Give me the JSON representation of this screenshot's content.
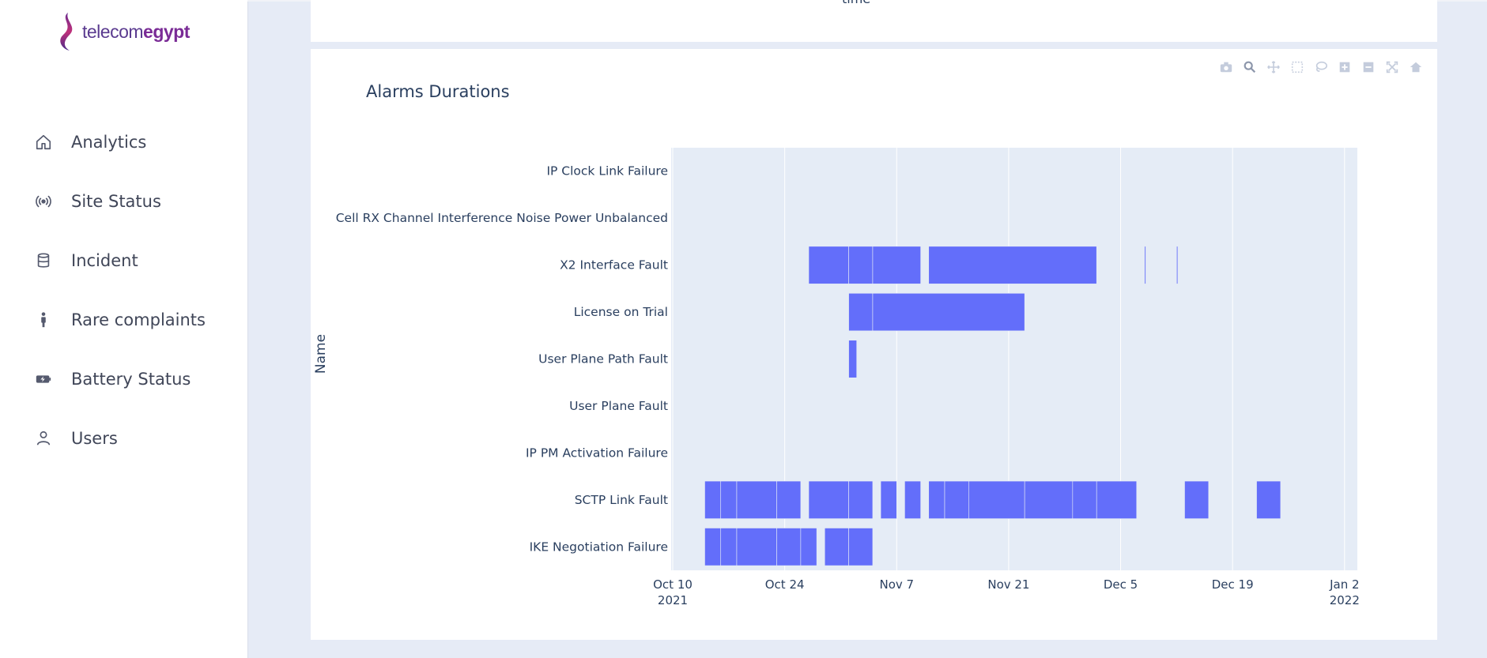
{
  "sidebar": {
    "logo": {
      "prefix": "telecom",
      "suffix": "egypt"
    },
    "items": [
      {
        "label": "Analytics",
        "icon": "home-icon"
      },
      {
        "label": "Site Status",
        "icon": "broadcast-icon"
      },
      {
        "label": "Incident",
        "icon": "database-icon"
      },
      {
        "label": "Rare complaints",
        "icon": "person-icon"
      },
      {
        "label": "Battery Status",
        "icon": "battery-icon"
      },
      {
        "label": "Users",
        "icon": "user-icon"
      }
    ]
  },
  "top_card": {
    "axis_label_cut": "time"
  },
  "chart": {
    "title": "Alarms Durations",
    "modebar": [
      "camera-icon",
      "zoom-icon",
      "pan-icon",
      "box-select-icon",
      "lasso-icon",
      "zoom-in-icon",
      "zoom-out-icon",
      "autoscale-icon",
      "reset-axes-icon"
    ]
  },
  "chart_data": {
    "type": "timeline",
    "title": "Alarms Durations",
    "xlabel": "",
    "ylabel": "Name",
    "x_ticks": [
      {
        "value": "2021-10-10",
        "label": "Oct 10",
        "sublabel": "2021"
      },
      {
        "value": "2021-10-24",
        "label": "Oct 24",
        "sublabel": ""
      },
      {
        "value": "2021-11-07",
        "label": "Nov 7",
        "sublabel": ""
      },
      {
        "value": "2021-11-21",
        "label": "Nov 21",
        "sublabel": ""
      },
      {
        "value": "2021-12-05",
        "label": "Dec 5",
        "sublabel": ""
      },
      {
        "value": "2021-12-19",
        "label": "Dec 19",
        "sublabel": ""
      },
      {
        "value": "2022-01-02",
        "label": "Jan 2",
        "sublabel": "2022"
      }
    ],
    "xlim": [
      "2021-10-10",
      "2022-01-04"
    ],
    "bar_color": "#636efa",
    "background": "#e5ecf6",
    "categories": [
      "IP Clock Link Failure",
      "Cell RX Channel Interference Noise Power Unbalanced",
      "X2 Interface Fault",
      "License on Trial",
      "User Plane Path Fault",
      "User Plane Fault",
      "IP PM Activation Failure",
      "SCTP Link Fault",
      "IKE Negotiation Failure"
    ],
    "series": [
      {
        "category": "X2 Interface Fault",
        "intervals": [
          [
            "2021-10-27",
            "2021-11-01"
          ],
          [
            "2021-11-01",
            "2021-11-04"
          ],
          [
            "2021-11-04",
            "2021-11-10"
          ],
          [
            "2021-11-11",
            "2021-12-02"
          ],
          [
            "2021-12-08",
            "2021-12-08"
          ],
          [
            "2021-12-12",
            "2021-12-12"
          ]
        ]
      },
      {
        "category": "License on Trial",
        "intervals": [
          [
            "2021-11-01",
            "2021-11-04"
          ],
          [
            "2021-11-04",
            "2021-11-23"
          ]
        ]
      },
      {
        "category": "User Plane Path Fault",
        "intervals": [
          [
            "2021-11-01",
            "2021-11-02"
          ]
        ]
      },
      {
        "category": "SCTP Link Fault",
        "intervals": [
          [
            "2021-10-14",
            "2021-10-16"
          ],
          [
            "2021-10-16",
            "2021-10-18"
          ],
          [
            "2021-10-18",
            "2021-10-23"
          ],
          [
            "2021-10-23",
            "2021-10-26"
          ],
          [
            "2021-10-27",
            "2021-11-01"
          ],
          [
            "2021-11-01",
            "2021-11-04"
          ],
          [
            "2021-11-05",
            "2021-11-07"
          ],
          [
            "2021-11-08",
            "2021-11-10"
          ],
          [
            "2021-11-11",
            "2021-11-13"
          ],
          [
            "2021-11-13",
            "2021-11-16"
          ],
          [
            "2021-11-16",
            "2021-11-23"
          ],
          [
            "2021-11-23",
            "2021-11-29"
          ],
          [
            "2021-11-29",
            "2021-12-02"
          ],
          [
            "2021-12-02",
            "2021-12-07"
          ],
          [
            "2021-12-13",
            "2021-12-16"
          ],
          [
            "2021-12-22",
            "2021-12-25"
          ]
        ]
      },
      {
        "category": "IKE Negotiation Failure",
        "intervals": [
          [
            "2021-10-14",
            "2021-10-16"
          ],
          [
            "2021-10-16",
            "2021-10-18"
          ],
          [
            "2021-10-18",
            "2021-10-23"
          ],
          [
            "2021-10-23",
            "2021-10-26"
          ],
          [
            "2021-10-26",
            "2021-10-28"
          ],
          [
            "2021-10-29",
            "2021-11-01"
          ],
          [
            "2021-11-01",
            "2021-11-04"
          ]
        ]
      }
    ]
  }
}
